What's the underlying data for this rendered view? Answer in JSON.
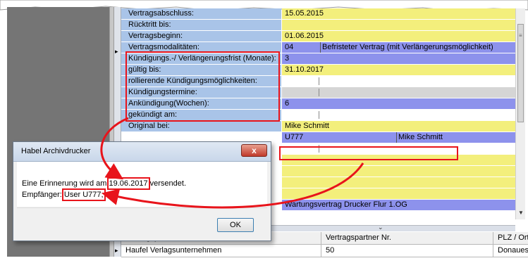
{
  "form_rows": [
    {
      "label": "Vertragsabschluss:",
      "value": "15.05.2015",
      "value_style": "y"
    },
    {
      "label": "Rücktritt bis:",
      "value": "",
      "value_style": "y"
    },
    {
      "label": "Vertragsbeginn:",
      "value": "01.06.2015",
      "value_style": "y"
    },
    {
      "label": "Vertragsmodalitäten:",
      "value": "04",
      "value2": "Befristeter Vertrag (mit Verlängerungsmöglichkeit)",
      "value_style": "b"
    },
    {
      "label": "Kündigungs.-/ Verlängerungsfrist (Monate):",
      "value": "3",
      "value_style": "b"
    },
    {
      "label": "gültig bis:",
      "value": "31.10.2017",
      "value_style": "y"
    },
    {
      "label": "rollierende Kündigungsmöglichkeiten:",
      "value": "",
      "value_style": "w"
    },
    {
      "label": "Kündigungstermine:",
      "value": "",
      "value_style": "n"
    },
    {
      "label": "Ankündigung(Wochen):",
      "value": "6",
      "value_style": "b"
    },
    {
      "label": "gekündigt am:",
      "value": "",
      "value_style": "w"
    },
    {
      "label": "Original bei:",
      "value": "Mike Schmitt",
      "value_style": "y"
    },
    {
      "label": "",
      "value": "U777",
      "value2": "Mike Schmitt",
      "value_style": "b"
    },
    {
      "label": "",
      "value": "",
      "value_style": "w"
    },
    {
      "label": "",
      "value": "",
      "value_style": "y"
    },
    {
      "label": "",
      "value": "",
      "value_style": "y"
    },
    {
      "label": "",
      "value": "",
      "value_style": "y"
    },
    {
      "label": "",
      "value": "",
      "value_style": "y"
    },
    {
      "label": "",
      "value": "Wartungsvertrag Drucker Flur 1.OG",
      "value_style": "b"
    }
  ],
  "partner_table": {
    "columns": [
      "Vertragspartner Name",
      "Vertragspartner Nr.",
      "PLZ / Ort"
    ],
    "rows": [
      [
        "Haufel Verlagsunternehmen",
        "50",
        "Donaues"
      ]
    ]
  },
  "dialog": {
    "title": "Habel Archivdrucker",
    "close_label": "x",
    "msg_prefix": "Eine Erinnerung wird am ",
    "msg_date": "19.06.2017",
    "msg_suffix": " versendet.",
    "recipient_label": "Empfänger: ",
    "recipient_value": "User U777;",
    "ok_label": "OK"
  },
  "icons": {
    "row_pointer": "row-pointer-icon",
    "scroll_grip": "scroll-grip-icon",
    "collapse": "chevron-down-icon",
    "close": "close-icon"
  },
  "colors": {
    "label_bg": "#a9c4e8",
    "value_yellow": "#f3ef7c",
    "value_blue": "#8d92ec",
    "highlight_red": "#e8141b",
    "app_dark": "#757575"
  }
}
